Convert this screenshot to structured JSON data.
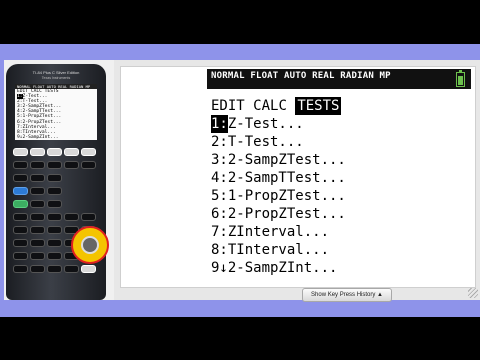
{
  "calculator": {
    "model": "TI-84 Plus C Silver Edition",
    "brand": "Texas Instruments",
    "mini_status": "NORMAL FLOAT AUTO REAL RADIAN MP",
    "mini_tabs": "EDIT CALC TESTS",
    "mini_items": [
      "1:Z-Test...",
      "2:T-Test...",
      "3:2-SampZTest...",
      "4:2-SampTTest...",
      "5:1-PropZTest...",
      "6:2-PropZTest...",
      "7:ZInterval...",
      "8:TInterval...",
      "9↓2-SampZInt..."
    ]
  },
  "screen": {
    "status": "NORMAL FLOAT AUTO REAL RADIAN MP",
    "battery_color": "#6dc14e",
    "tabs": [
      {
        "label": "EDIT",
        "active": false
      },
      {
        "label": "CALC",
        "active": false
      },
      {
        "label": "TESTS",
        "active": true
      }
    ],
    "menu": [
      {
        "key": "1:",
        "label": "Z-Test..."
      },
      {
        "key": "2:",
        "label": "T-Test..."
      },
      {
        "key": "3:",
        "label": "2-SampZTest..."
      },
      {
        "key": "4:",
        "label": "2-SampTTest..."
      },
      {
        "key": "5:",
        "label": "1-PropZTest..."
      },
      {
        "key": "6:",
        "label": "2-PropZTest..."
      },
      {
        "key": "7:",
        "label": "ZInterval..."
      },
      {
        "key": "8:",
        "label": "TInterval..."
      },
      {
        "key": "9↓",
        "label": "2-SampZInt..."
      }
    ],
    "selected_index": 0
  },
  "footer": {
    "history_button": "Show Key Press History ▲"
  },
  "colors": {
    "frame": "#8e93ea",
    "window": "#e7e7e7",
    "highlight_yellow": "#f4c400",
    "highlight_red": "#e02020"
  }
}
